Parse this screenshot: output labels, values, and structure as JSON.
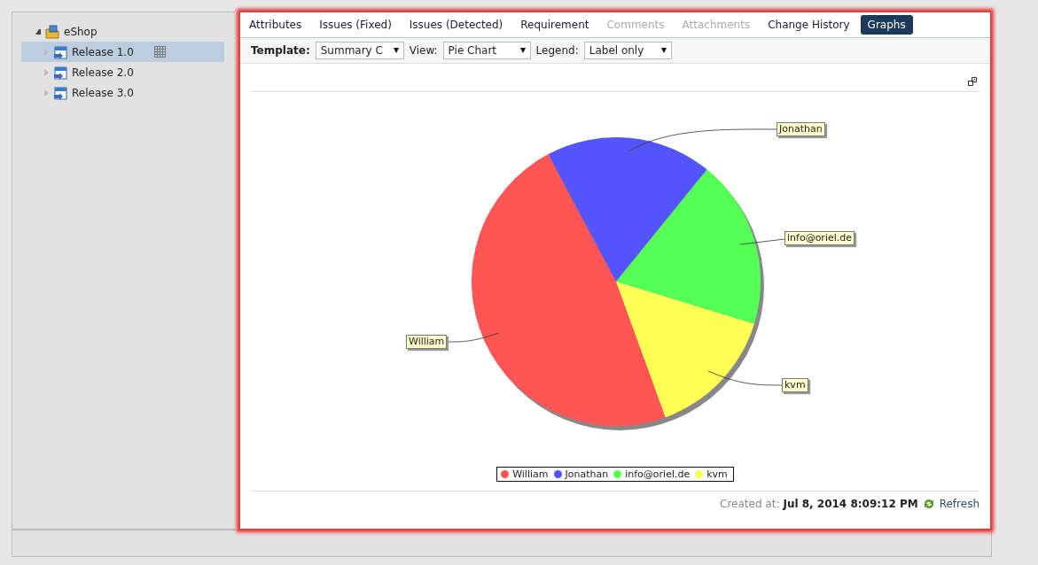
{
  "tree": {
    "items": [
      {
        "label": "eShop",
        "expanded": true,
        "selected": false,
        "children": [
          {
            "label": "Release 1.0",
            "expanded": false,
            "selected": true
          },
          {
            "label": "Release 2.0",
            "expanded": false,
            "selected": false
          },
          {
            "label": "Release 3.0",
            "expanded": false,
            "selected": false
          }
        ]
      }
    ]
  },
  "tabs": [
    {
      "label": "Attributes",
      "selected": false,
      "disabled": false
    },
    {
      "label": "Issues (Fixed)",
      "selected": false,
      "disabled": false
    },
    {
      "label": "Issues (Detected)",
      "selected": false,
      "disabled": false
    },
    {
      "label": "Requirement",
      "selected": false,
      "disabled": false
    },
    {
      "label": "Comments",
      "selected": false,
      "disabled": true
    },
    {
      "label": "Attachments",
      "selected": false,
      "disabled": true
    },
    {
      "label": "Change History",
      "selected": false,
      "disabled": false
    },
    {
      "label": "Graphs",
      "selected": true,
      "disabled": false
    }
  ],
  "toolbar": [
    {
      "label": "Template:",
      "value": "Summary C"
    },
    {
      "label": "View:",
      "value": "Pie Chart"
    },
    {
      "label": "Legend:",
      "value": "Label only"
    }
  ],
  "chart": {
    "callouts": [
      "Jonathan",
      "info@oriel.de",
      "kvm",
      "William"
    ],
    "legend": [
      {
        "label": "William",
        "color": "#ff5555"
      },
      {
        "label": "Jonathan",
        "color": "#5555ff"
      },
      {
        "label": "info@oriel.de",
        "color": "#55ff55"
      },
      {
        "label": "kvm",
        "color": "#ffff55"
      }
    ]
  },
  "footer": {
    "created_label": "Created at:",
    "created_value": "Jul 8, 2014 8:09:12 PM",
    "refresh": "Refresh"
  }
}
